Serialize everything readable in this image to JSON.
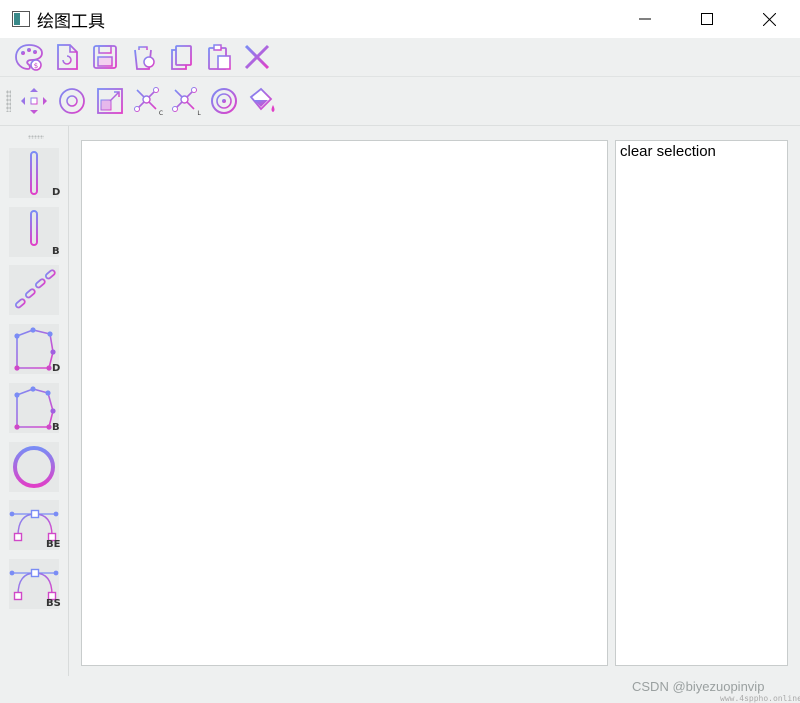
{
  "window": {
    "title": "绘图工具",
    "controls": [
      "minimize",
      "maximize",
      "close"
    ]
  },
  "toolbar_file": [
    {
      "name": "palette-icon"
    },
    {
      "name": "new-file-icon"
    },
    {
      "name": "save-icon"
    },
    {
      "name": "clear-icon"
    },
    {
      "name": "copy-icon"
    },
    {
      "name": "paste-icon"
    },
    {
      "name": "delete-icon"
    }
  ],
  "toolbar_edit": [
    {
      "name": "move-icon"
    },
    {
      "name": "rotate-icon"
    },
    {
      "name": "scale-icon"
    },
    {
      "name": "clip-c-icon",
      "badge": "C"
    },
    {
      "name": "clip-l-icon",
      "badge": "L"
    },
    {
      "name": "target-icon"
    },
    {
      "name": "fill-bucket-icon"
    }
  ],
  "draw_tools": [
    {
      "name": "line-dda",
      "label": "D"
    },
    {
      "name": "line-bresenham",
      "label": "B"
    },
    {
      "name": "polyline"
    },
    {
      "name": "polygon-dda",
      "label": "D"
    },
    {
      "name": "polygon-bresenham",
      "label": "B"
    },
    {
      "name": "ellipse"
    },
    {
      "name": "curve-bezier",
      "label": "BE"
    },
    {
      "name": "curve-bspline",
      "label": "BS"
    }
  ],
  "selection_panel": {
    "items": [
      "clear selection"
    ]
  },
  "watermark": "CSDN @biyezuopinvip",
  "watermark_small": "www.4sppho.online",
  "colors": {
    "icon_gradient_start": "#8a6cf0",
    "icon_gradient_end": "#e040c8",
    "icon_blue": "#6a7ef0"
  }
}
